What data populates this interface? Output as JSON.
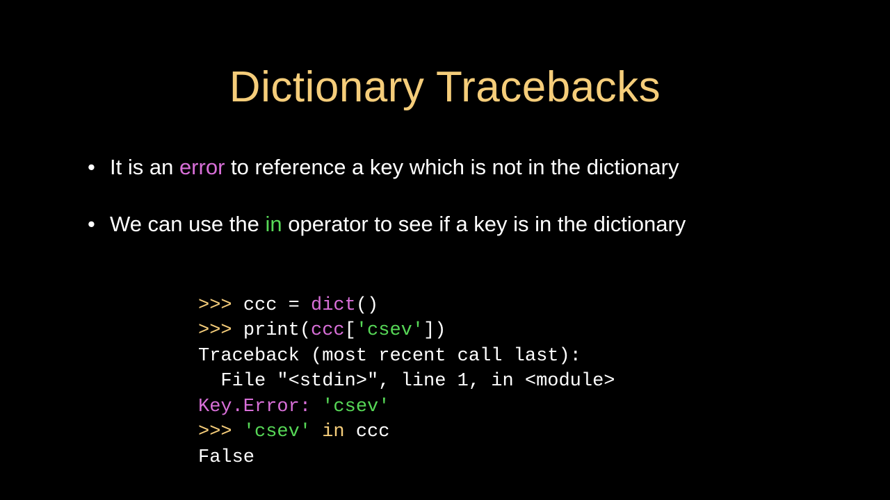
{
  "title": "Dictionary Tracebacks",
  "bullets": [
    {
      "pre": "It is an ",
      "kw": "error",
      "post": " to reference a key which is not in the dictionary",
      "kwClass": "kw-error"
    },
    {
      "pre": "We can use the ",
      "kw": "in",
      "post": " operator to see if a key is in the dictionary",
      "kwClass": "kw-in"
    }
  ],
  "code": {
    "l1": {
      "prompt": ">>> ",
      "a": "ccc = ",
      "fn": "dict",
      "b": "()"
    },
    "l2": {
      "prompt": ">>> ",
      "a": "print(",
      "var": "ccc",
      "b": "[",
      "str": "'csev'",
      "c": "])"
    },
    "l3": "Traceback (most recent call last):",
    "l4": "  File \"<stdin>\", line 1, in <module>",
    "l5": {
      "err": "Key.Error: ",
      "str": "'csev'"
    },
    "l6": {
      "prompt": ">>> ",
      "str": "'csev'",
      "sp": " ",
      "kw": "in",
      "rest": " ccc"
    },
    "l7": "False"
  }
}
